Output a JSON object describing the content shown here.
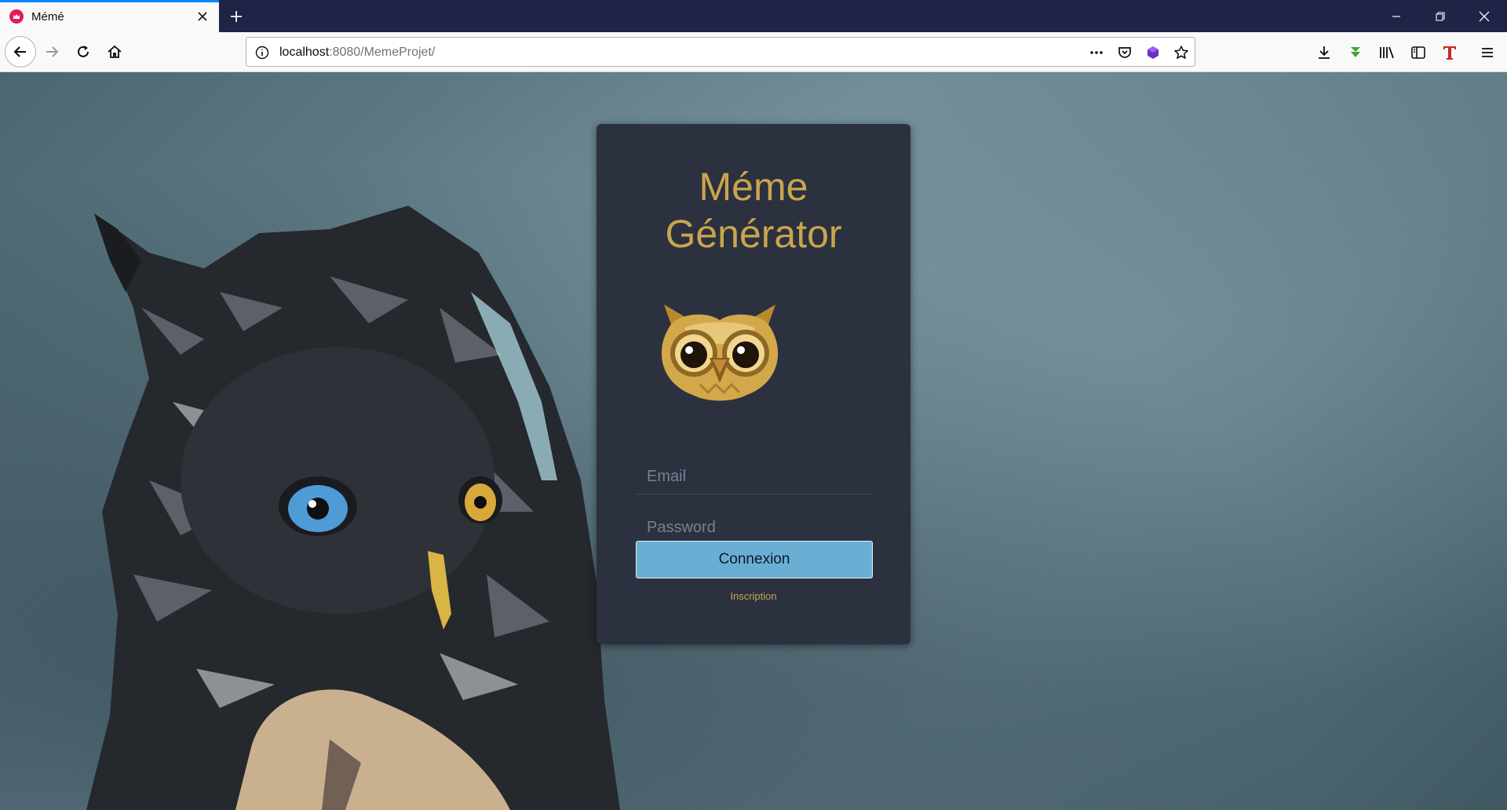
{
  "browser": {
    "tab_title": "Mémé",
    "url_host": "localhost",
    "url_rest": ":8080/MemeProjet/",
    "icons": {
      "tab_favicon": "meme-favicon-icon",
      "tab_close": "close-icon",
      "new_tab": "plus-icon",
      "minimize": "minimize-icon",
      "restore": "restore-icon",
      "close_window": "close-icon",
      "back": "back-arrow-icon",
      "forward": "forward-arrow-icon",
      "reload": "reload-icon",
      "home": "home-icon",
      "site_info": "info-icon",
      "page_actions": "more-dots-icon",
      "pocket": "pocket-icon",
      "extension": "purple-cube-icon",
      "bookmark": "star-icon",
      "downloads": "download-icon",
      "green_extension": "green-arrow-icon",
      "library": "library-icon",
      "sidebar": "sidebar-icon",
      "translate": "red-t-icon",
      "menu": "hamburger-menu-icon"
    },
    "accent_color": "#0a84ff",
    "chrome_color": "#1f2345"
  },
  "page": {
    "title_line1": "Méme",
    "title_line2": "Générator",
    "email_placeholder": "Email",
    "password_placeholder": "Password",
    "login_label": "Connexion",
    "register_label": "Inscription",
    "colors": {
      "gold": "#c9a54d",
      "card": "#2c3140",
      "button": "#6aaed4"
    }
  }
}
